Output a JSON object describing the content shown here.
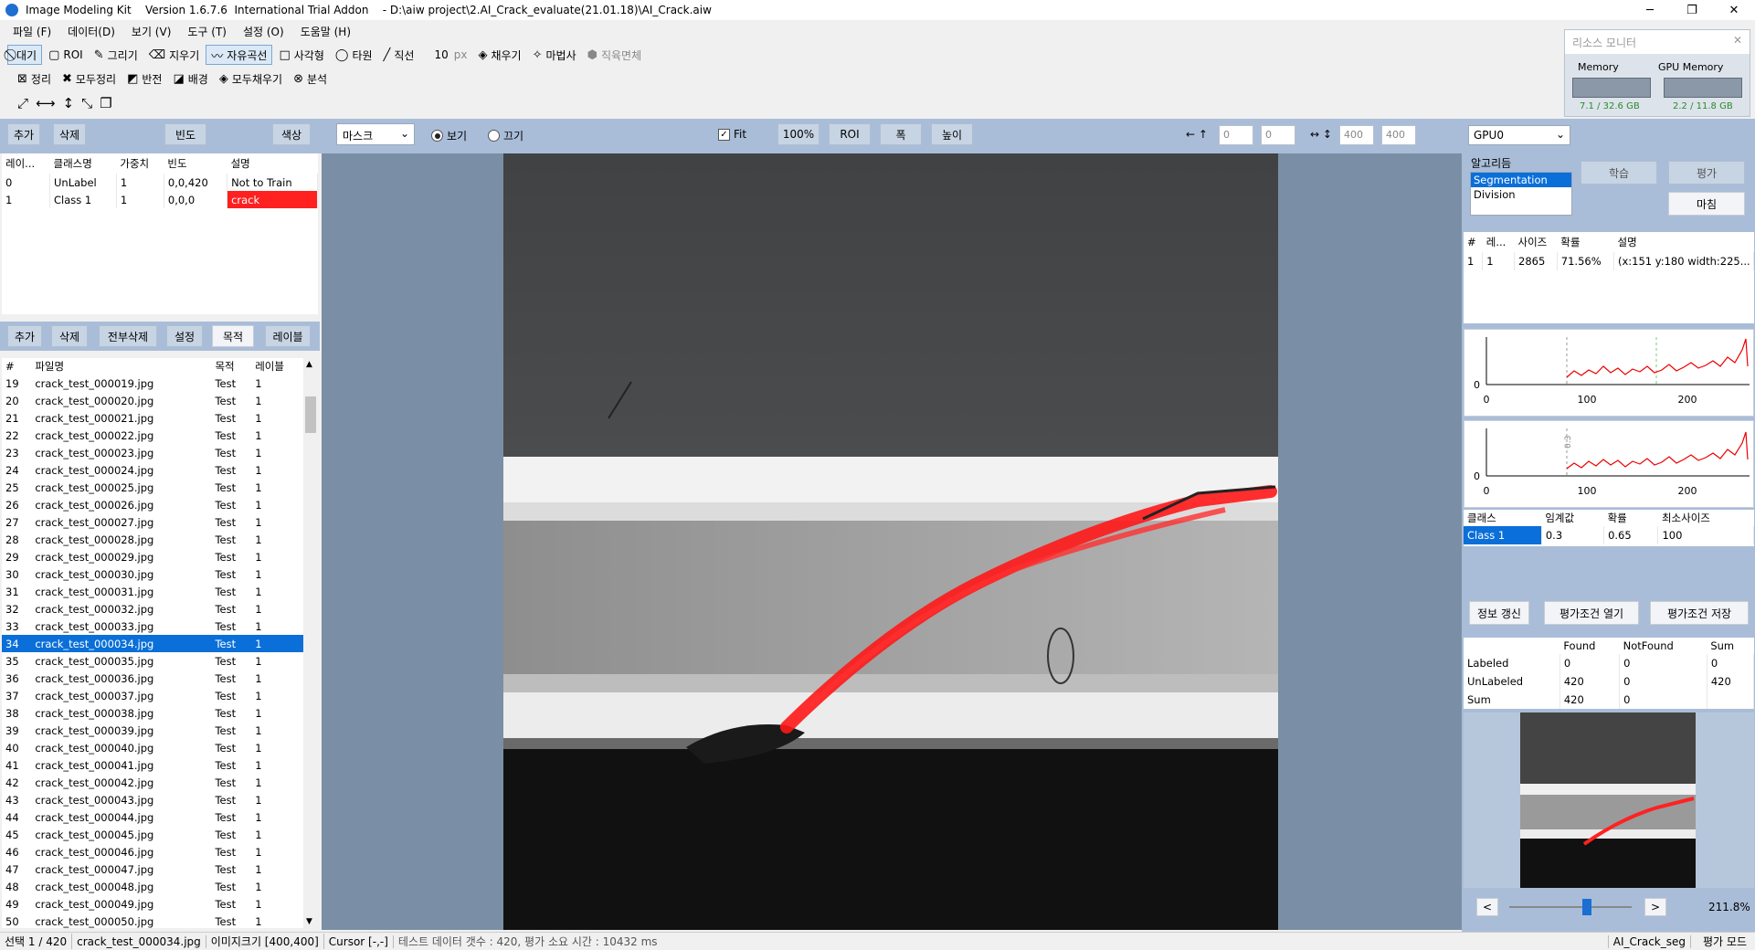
{
  "window": {
    "title": "Image Modeling Kit    Version 1.6.7.6  International Trial Addon    - D:\\aiw project\\2.AI_Crack_evaluate(21.01.18)\\AI_Crack.aiw",
    "min": "─",
    "max": "❐",
    "close": "✕"
  },
  "menu": [
    "파일 (F)",
    "데이터(D)",
    "보기 (V)",
    "도구 (T)",
    "설정 (O)",
    "도움말 (H)"
  ],
  "toolbar1": [
    {
      "icon": "⃠",
      "label": "대기",
      "on": true,
      "name": "wait-tool"
    },
    {
      "icon": "▢",
      "label": "ROI",
      "on": false,
      "name": "roi-tool"
    },
    {
      "icon": "✎",
      "label": "그리기",
      "on": false,
      "name": "draw-tool"
    },
    {
      "icon": "⌫",
      "label": "지우기",
      "on": false,
      "name": "erase-tool"
    },
    {
      "icon": "〰",
      "label": "자유곡선",
      "on": true,
      "name": "freecurve-tool"
    },
    {
      "icon": "□",
      "label": "사각형",
      "on": false,
      "name": "rect-tool"
    },
    {
      "icon": "◯",
      "label": "타원",
      "on": false,
      "name": "ellipse-tool"
    },
    {
      "icon": "╱",
      "label": "직선",
      "on": false,
      "name": "line-tool"
    }
  ],
  "brush": {
    "value": "10",
    "unit": "px"
  },
  "toolbar1b": [
    {
      "icon": "◈",
      "label": "채우기",
      "name": "fill-tool"
    },
    {
      "icon": "✧",
      "label": "마법사",
      "name": "wand-tool"
    },
    {
      "icon": "⬢",
      "label": "직육면체",
      "name": "cuboid-tool",
      "disabled": true
    }
  ],
  "toolbar2": [
    {
      "icon": "⊠",
      "label": "정리",
      "name": "clean-tool"
    },
    {
      "icon": "✖",
      "label": "모두정리",
      "name": "clean-all-tool"
    },
    {
      "icon": "◩",
      "label": "반전",
      "name": "invert-tool"
    },
    {
      "icon": "◪",
      "label": "배경",
      "name": "background-tool"
    },
    {
      "icon": "◈",
      "label": "모두채우기",
      "name": "fill-all-tool"
    },
    {
      "icon": "⊗",
      "label": "분석",
      "name": "analyze-tool"
    }
  ],
  "toolbar3": [
    "⤢",
    "⟷",
    "↕",
    "⤡",
    "❐"
  ],
  "classbar": {
    "add": "추가",
    "del": "삭제",
    "freq": "빈도",
    "color": "색상",
    "mask_select": "마스크",
    "view": "보기",
    "off": "끄기"
  },
  "classTable": {
    "headers": [
      "레이...",
      "클래스명",
      "가중치",
      "빈도",
      "설명"
    ],
    "rows": [
      [
        "0",
        "UnLabel",
        "1",
        "0,0,420",
        "Not to Train"
      ],
      [
        "1",
        "Class 1",
        "1",
        "0,0,0",
        "crack"
      ]
    ]
  },
  "filebar": {
    "add": "추가",
    "del": "삭제",
    "delall": "전부삭제",
    "set": "설정",
    "purpose": "목적",
    "label": "레이블"
  },
  "fileTable": {
    "headers": [
      "#",
      "파일명",
      "목적",
      "레이블"
    ],
    "rows": [
      [
        "19",
        "crack_test_000019.jpg",
        "Test",
        "1"
      ],
      [
        "20",
        "crack_test_000020.jpg",
        "Test",
        "1"
      ],
      [
        "21",
        "crack_test_000021.jpg",
        "Test",
        "1"
      ],
      [
        "22",
        "crack_test_000022.jpg",
        "Test",
        "1"
      ],
      [
        "23",
        "crack_test_000023.jpg",
        "Test",
        "1"
      ],
      [
        "24",
        "crack_test_000024.jpg",
        "Test",
        "1"
      ],
      [
        "25",
        "crack_test_000025.jpg",
        "Test",
        "1"
      ],
      [
        "26",
        "crack_test_000026.jpg",
        "Test",
        "1"
      ],
      [
        "27",
        "crack_test_000027.jpg",
        "Test",
        "1"
      ],
      [
        "28",
        "crack_test_000028.jpg",
        "Test",
        "1"
      ],
      [
        "29",
        "crack_test_000029.jpg",
        "Test",
        "1"
      ],
      [
        "30",
        "crack_test_000030.jpg",
        "Test",
        "1"
      ],
      [
        "31",
        "crack_test_000031.jpg",
        "Test",
        "1"
      ],
      [
        "32",
        "crack_test_000032.jpg",
        "Test",
        "1"
      ],
      [
        "33",
        "crack_test_000033.jpg",
        "Test",
        "1"
      ],
      [
        "34",
        "crack_test_000034.jpg",
        "Test",
        "1"
      ],
      [
        "35",
        "crack_test_000035.jpg",
        "Test",
        "1"
      ],
      [
        "36",
        "crack_test_000036.jpg",
        "Test",
        "1"
      ],
      [
        "37",
        "crack_test_000037.jpg",
        "Test",
        "1"
      ],
      [
        "38",
        "crack_test_000038.jpg",
        "Test",
        "1"
      ],
      [
        "39",
        "crack_test_000039.jpg",
        "Test",
        "1"
      ],
      [
        "40",
        "crack_test_000040.jpg",
        "Test",
        "1"
      ],
      [
        "41",
        "crack_test_000041.jpg",
        "Test",
        "1"
      ],
      [
        "42",
        "crack_test_000042.jpg",
        "Test",
        "1"
      ],
      [
        "43",
        "crack_test_000043.jpg",
        "Test",
        "1"
      ],
      [
        "44",
        "crack_test_000044.jpg",
        "Test",
        "1"
      ],
      [
        "45",
        "crack_test_000045.jpg",
        "Test",
        "1"
      ],
      [
        "46",
        "crack_test_000046.jpg",
        "Test",
        "1"
      ],
      [
        "47",
        "crack_test_000047.jpg",
        "Test",
        "1"
      ],
      [
        "48",
        "crack_test_000048.jpg",
        "Test",
        "1"
      ],
      [
        "49",
        "crack_test_000049.jpg",
        "Test",
        "1"
      ],
      [
        "50",
        "crack_test_000050.jpg",
        "Test",
        "1"
      ]
    ],
    "selected": "34"
  },
  "viewbar": {
    "fit": "Fit",
    "zoom100": "100%",
    "roi": "ROI",
    "width": "폭",
    "height": "높이",
    "arrowX": "← ↑",
    "x": "0",
    "y": "0",
    "arrowW": "↔ ↕",
    "w": "400",
    "h": "400"
  },
  "resource": {
    "title": "리소스 모니터",
    "mem_label": "Memory",
    "mem_value": "7.1 / 32.6 GB",
    "gpu_label": "GPU Memory",
    "gpu_value": "2.2 / 11.8 GB"
  },
  "right": {
    "gpu": "GPU0",
    "algo_label": "알고리듬",
    "algos": [
      "Segmentation",
      "Division"
    ],
    "train": "학습",
    "eval": "평가",
    "finish": "마침",
    "detHeaders": [
      "#",
      "레...",
      "사이즈",
      "확률",
      "설명"
    ],
    "detRow": [
      "1",
      "1",
      "2865",
      "71.56%",
      "(x:151 y:180 width:225..."
    ],
    "hist_ticks": [
      "0",
      "100",
      "200"
    ],
    "hist_y": "0",
    "hist_mark": "0.3",
    "clsHeaders": [
      "클래스",
      "임계값",
      "확률",
      "최소사이즈"
    ],
    "clsRow": [
      "Class 1",
      "0.3",
      "0.65",
      "100"
    ],
    "refresh": "정보 갱신",
    "open_cond": "평가조건 열기",
    "save_cond": "평가조건 저장",
    "statHeaders": [
      "",
      "Found",
      "NotFound",
      "Sum"
    ],
    "statRows": [
      [
        "Labeled",
        "0",
        "0",
        "0"
      ],
      [
        "UnLabeled",
        "420",
        "0",
        "420"
      ],
      [
        "Sum",
        "420",
        "0",
        ""
      ]
    ],
    "prev": "<",
    "next": ">",
    "zoom": "211.8%"
  },
  "status": {
    "sel": "선택 1 / 420",
    "file": "crack_test_000034.jpg",
    "size": "이미지크기 [400,400]",
    "cursor": "Cursor [-,-]",
    "info": "테스트 데이터 갯수 : 420,   평가 소요 시간 : 10432 ms",
    "project": "AI_Crack_seg",
    "mode": "평가 모드"
  },
  "colors": {
    "accent": "#0a6fd8",
    "crack": "#ff2020",
    "band": "#a9bdd8"
  }
}
